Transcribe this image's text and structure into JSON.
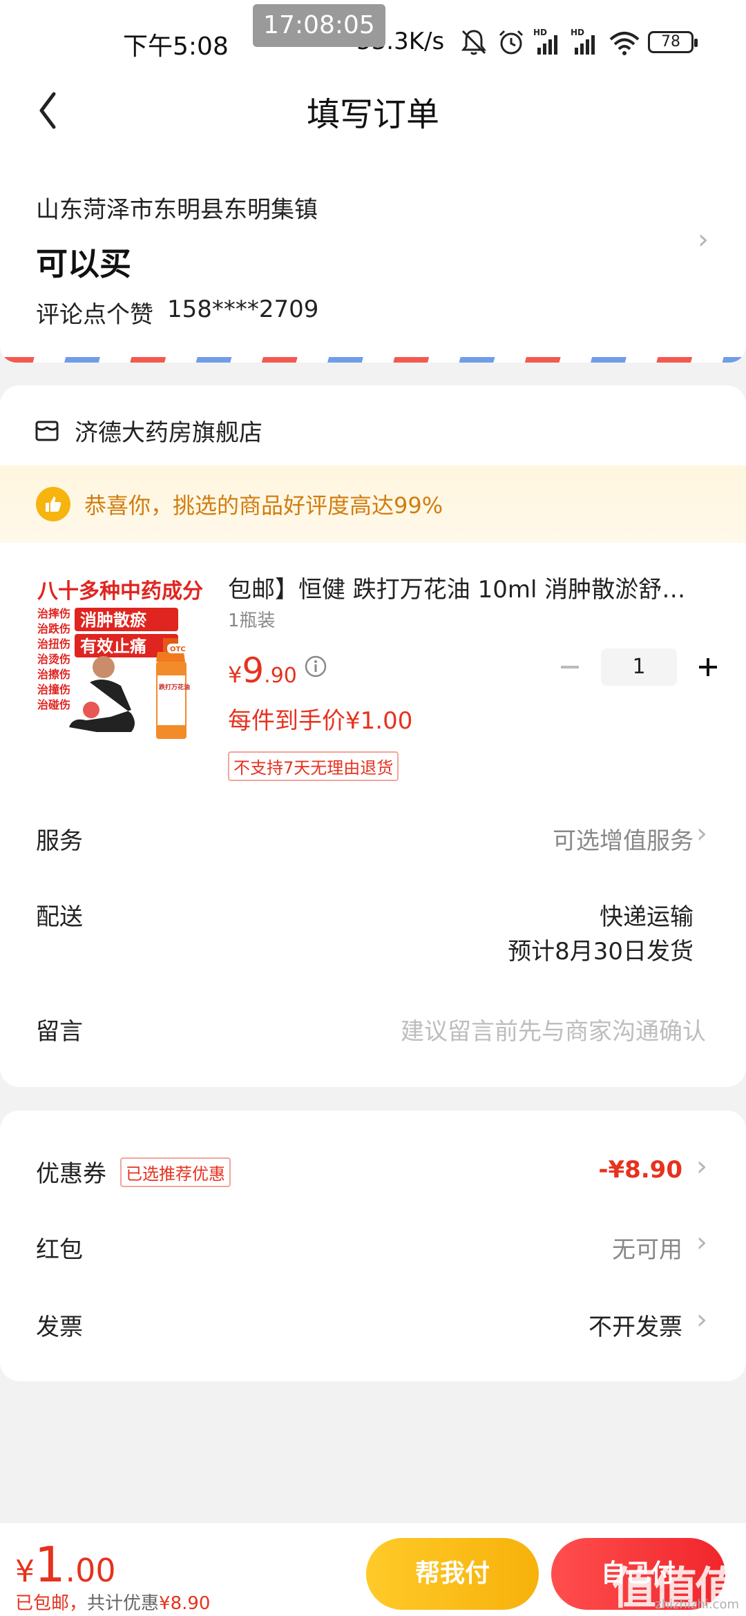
{
  "status_bar": {
    "time": "下午5:08",
    "clock_overlay": "17:08:05",
    "net_speed": "53.3K/s",
    "battery": "78",
    "signal_tag": "HD"
  },
  "header": {
    "title": "填写订单"
  },
  "address": {
    "region": "山东菏泽市东明县东明集镇",
    "name": "可以买",
    "contact_name": "评论点个赞",
    "phone": "158****2709"
  },
  "store": {
    "name": "济德大药房旗舰店"
  },
  "promo": {
    "text": "恭喜你，挑选的商品好评度高达99%"
  },
  "product": {
    "image_caption_top": "八十多种中药成分",
    "image_caption_mid1": "消肿散瘀",
    "image_caption_mid2": "有效止痛",
    "image_tags": [
      "治摔伤",
      "治跌伤",
      "治扭伤",
      "治烫伤",
      "治擦伤",
      "治撞伤",
      "治碰伤"
    ],
    "image_bottle_label": "跌打万花油",
    "image_otc": "OTC",
    "title": "包邮】恒健 跌打万花油 10ml 消肿散淤舒…",
    "spec": "1瓶装",
    "price_currency": "¥",
    "price_int": "9",
    "price_dec": ".90",
    "unit_price": "每件到手价¥1.00",
    "return_policy": "不支持7天无理由退货",
    "quantity": "1"
  },
  "rows": {
    "service_label": "服务",
    "service_value": "可选增值服务",
    "delivery_label": "配送",
    "delivery_method": "快递运输",
    "delivery_eta": "预计8月30日发货",
    "note_label": "留言",
    "note_placeholder": "建议留言前先与商家沟通确认"
  },
  "discounts": {
    "coupon_label": "优惠券",
    "coupon_tag": "已选推荐优惠",
    "coupon_value": "-¥8.90",
    "redpacket_label": "红包",
    "redpacket_value": "无可用",
    "invoice_label": "发票",
    "invoice_value": "不开发票"
  },
  "bottom": {
    "total_currency": "¥",
    "total_int": "1",
    "total_dec": ".00",
    "shipping_note": "已包邮，",
    "savings_label": "共计优惠",
    "savings_value": "¥8.90",
    "help_pay_label": "帮我付",
    "self_pay_label": "自己付",
    "watermark": "值值值",
    "watermark_site": "zhizhizhi.com"
  },
  "colors": {
    "accent_red": "#e6321e",
    "promo_orange": "#d27c10",
    "help_pay_yellow": "#f7b10b",
    "self_pay_red": "#f0262b"
  }
}
